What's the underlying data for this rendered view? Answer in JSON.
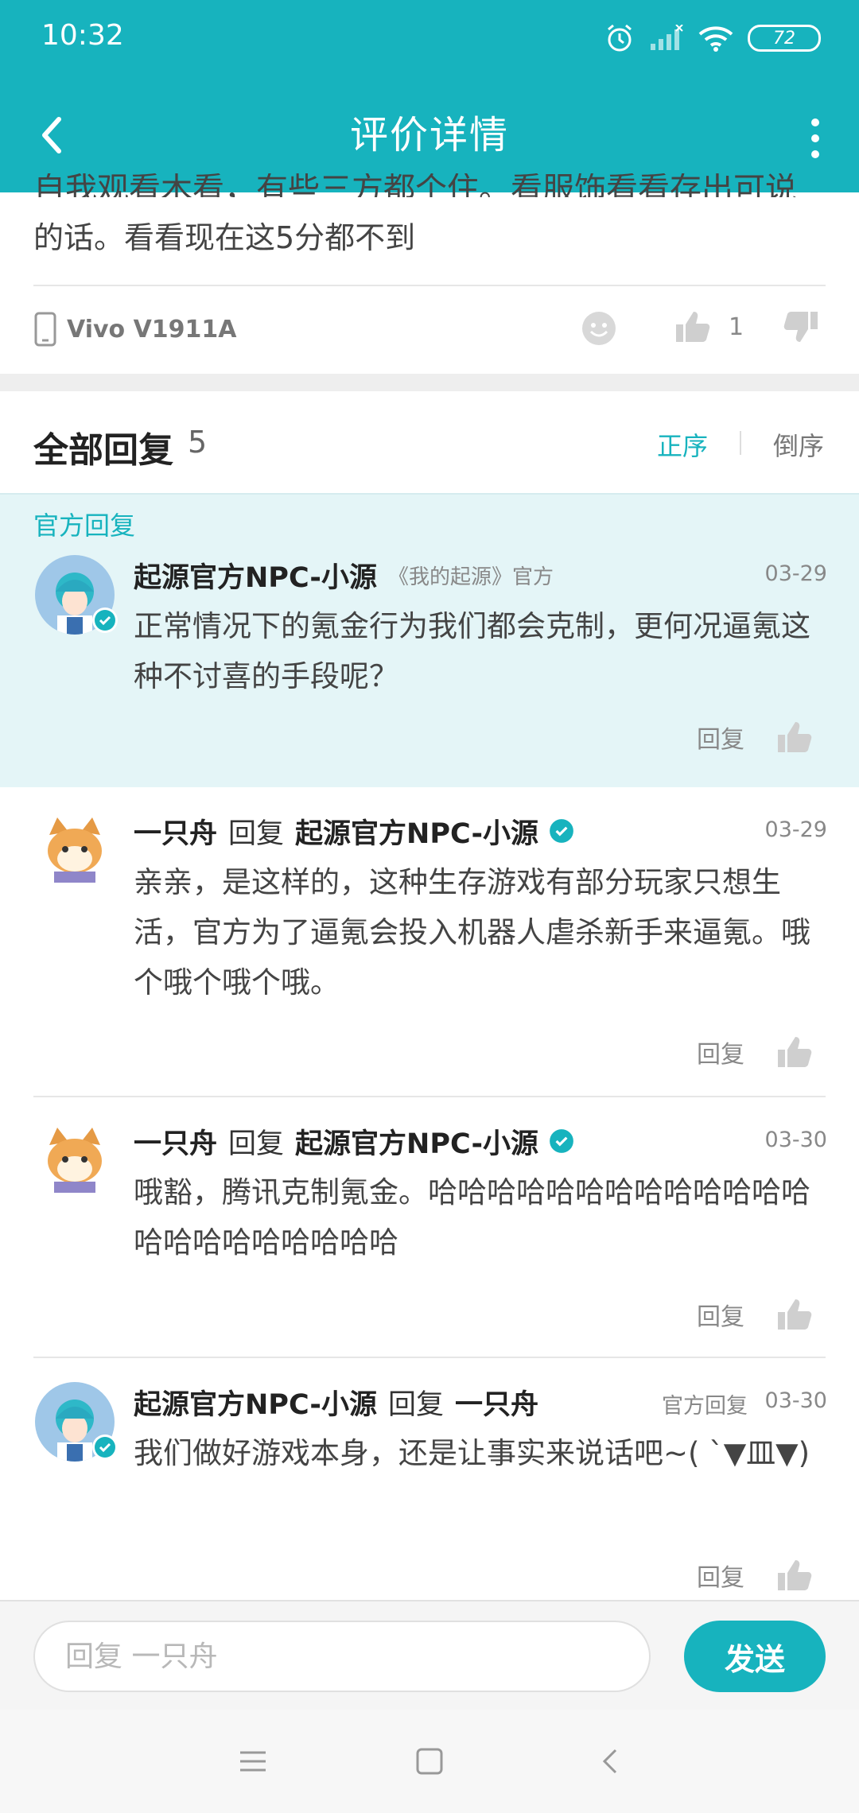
{
  "colors": {
    "accent": "#17b3be",
    "official_bg": "#e4f5f7"
  },
  "status_bar": {
    "time": "10:32",
    "battery": "72"
  },
  "header": {
    "title": "评价详情"
  },
  "review": {
    "cut_text": "自我观看木看，有些三方都个住。看服饰看看存出可说之",
    "text_tail": "的话。看看现在这5分都不到",
    "device": "Vivo V1911A",
    "like_count": "1"
  },
  "replies_header": {
    "label": "全部回复",
    "count": "5",
    "sort_asc": "正序",
    "sort_desc": "倒序"
  },
  "official_tag": "官方回复",
  "replies": [
    {
      "name": "起源官方NPC-小源",
      "subtitle": "《我的起源》官方",
      "date": "03-29",
      "body": "正常情况下的氪金行为我们都会克制，更何况逼氪这种不讨喜的手段呢？",
      "reply_label": "回复"
    },
    {
      "name": "一只舟",
      "reply_word": "回复",
      "target": "起源官方NPC-小源",
      "date": "03-29",
      "body": "亲亲，是这样的，这种生存游戏有部分玩家只想生活，官方为了逼氪会投入机器人虐杀新手来逼氪。哦个哦个哦个哦。",
      "reply_label": "回复"
    },
    {
      "name": "一只舟",
      "reply_word": "回复",
      "target": "起源官方NPC-小源",
      "date": "03-30",
      "body": "哦豁，腾讯克制氪金。哈哈哈哈哈哈哈哈哈哈哈哈哈哈哈哈哈哈哈哈哈哈",
      "reply_label": "回复"
    },
    {
      "name": "起源官方NPC-小源",
      "reply_word": "回复",
      "target": "一只舟",
      "official_tag": "官方回复",
      "date": "03-30",
      "body": "我们做好游戏本身，还是让事实来说话吧~( ˋ▼皿▼)",
      "reply_label": "回复"
    }
  ],
  "input": {
    "placeholder": "回复 一只舟",
    "send_label": "发送"
  }
}
